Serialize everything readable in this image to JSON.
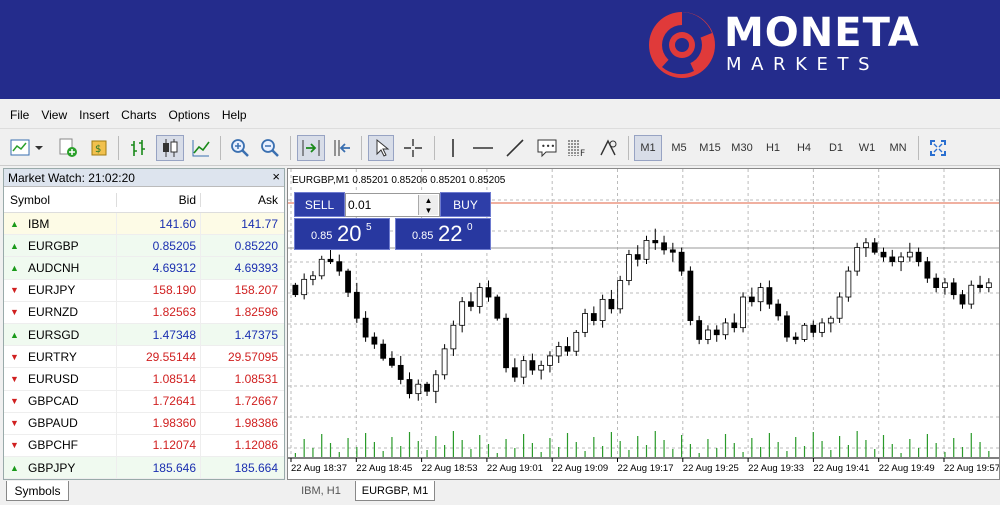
{
  "brand": {
    "name": "MONETA",
    "sub": "MARKETS"
  },
  "menu": [
    "File",
    "View",
    "Insert",
    "Charts",
    "Options",
    "Help"
  ],
  "timeframes": [
    "M1",
    "M5",
    "M15",
    "M30",
    "H1",
    "H4",
    "D1",
    "W1",
    "MN"
  ],
  "active_timeframe": "M1",
  "market_watch": {
    "title": "Market Watch: 21:02:20",
    "close": "×",
    "headers": {
      "symbol": "Symbol",
      "bid": "Bid",
      "ask": "Ask"
    },
    "rows": [
      {
        "symbol": "IBM",
        "bid": "141.60",
        "ask": "141.77",
        "dir": "up"
      },
      {
        "symbol": "EURGBP",
        "bid": "0.85205",
        "ask": "0.85220",
        "dir": "up"
      },
      {
        "symbol": "AUDCNH",
        "bid": "4.69312",
        "ask": "4.69393",
        "dir": "up"
      },
      {
        "symbol": "EURJPY",
        "bid": "158.190",
        "ask": "158.207",
        "dir": "down"
      },
      {
        "symbol": "EURNZD",
        "bid": "1.82563",
        "ask": "1.82596",
        "dir": "down"
      },
      {
        "symbol": "EURSGD",
        "bid": "1.47348",
        "ask": "1.47375",
        "dir": "up"
      },
      {
        "symbol": "EURTRY",
        "bid": "29.55144",
        "ask": "29.57095",
        "dir": "down"
      },
      {
        "symbol": "EURUSD",
        "bid": "1.08514",
        "ask": "1.08531",
        "dir": "down"
      },
      {
        "symbol": "GBPCAD",
        "bid": "1.72641",
        "ask": "1.72667",
        "dir": "down"
      },
      {
        "symbol": "GBPAUD",
        "bid": "1.98360",
        "ask": "1.98386",
        "dir": "down"
      },
      {
        "symbol": "GBPCHF",
        "bid": "1.12074",
        "ask": "1.12086",
        "dir": "down"
      },
      {
        "symbol": "GBPJPY",
        "bid": "185.646",
        "ask": "185.664",
        "dir": "up"
      }
    ],
    "tab": "Symbols"
  },
  "chart": {
    "info": "EURGBP,M1  0.85201 0.85206 0.85201 0.85205",
    "sell_label": "SELL",
    "buy_label": "BUY",
    "lot": "0.01",
    "sell_quote": {
      "pre": "0.85",
      "big": "20",
      "sup": "5"
    },
    "buy_quote": {
      "pre": "0.85",
      "big": "22",
      "sup": "0"
    },
    "time_labels": [
      "22 Aug 18:37",
      "22 Aug 18:45",
      "22 Aug 18:53",
      "22 Aug 19:01",
      "22 Aug 19:09",
      "22 Aug 19:17",
      "22 Aug 19:25",
      "22 Aug 19:33",
      "22 Aug 19:41",
      "22 Aug 19:49",
      "22 Aug 19:57"
    ],
    "candles": [
      [
        0.8522,
        0.85222,
        0.8521,
        0.85212
      ],
      [
        0.85212,
        0.8523,
        0.85208,
        0.85225
      ],
      [
        0.85225,
        0.85232,
        0.8522,
        0.85228
      ],
      [
        0.85228,
        0.85245,
        0.85225,
        0.85242
      ],
      [
        0.85242,
        0.8525,
        0.85238,
        0.8524
      ],
      [
        0.8524,
        0.85246,
        0.85228,
        0.85232
      ],
      [
        0.85232,
        0.85234,
        0.8521,
        0.85214
      ],
      [
        0.85214,
        0.85222,
        0.85188,
        0.85192
      ],
      [
        0.85192,
        0.85198,
        0.85172,
        0.85176
      ],
      [
        0.85176,
        0.8518,
        0.85166,
        0.8517
      ],
      [
        0.8517,
        0.85174,
        0.85156,
        0.85158
      ],
      [
        0.85158,
        0.85164,
        0.8515,
        0.85152
      ],
      [
        0.85152,
        0.8516,
        0.85136,
        0.8514
      ],
      [
        0.8514,
        0.85146,
        0.85124,
        0.85128
      ],
      [
        0.85128,
        0.8514,
        0.85122,
        0.85136
      ],
      [
        0.85136,
        0.85138,
        0.85126,
        0.8513
      ],
      [
        0.8513,
        0.85148,
        0.8512,
        0.85144
      ],
      [
        0.85144,
        0.8517,
        0.8514,
        0.85166
      ],
      [
        0.85166,
        0.8519,
        0.8516,
        0.85186
      ],
      [
        0.85186,
        0.8521,
        0.8518,
        0.85206
      ],
      [
        0.85206,
        0.85214,
        0.85198,
        0.85202
      ],
      [
        0.85202,
        0.85222,
        0.85196,
        0.85218
      ],
      [
        0.85218,
        0.85224,
        0.85206,
        0.8521
      ],
      [
        0.8521,
        0.85212,
        0.8519,
        0.85192
      ],
      [
        0.85192,
        0.85196,
        0.85146,
        0.8515
      ],
      [
        0.8515,
        0.85158,
        0.85138,
        0.85142
      ],
      [
        0.85142,
        0.8516,
        0.85136,
        0.85156
      ],
      [
        0.85156,
        0.85162,
        0.85144,
        0.85148
      ],
      [
        0.85148,
        0.85156,
        0.8514,
        0.85152
      ],
      [
        0.85152,
        0.85164,
        0.85146,
        0.8516
      ],
      [
        0.8516,
        0.85172,
        0.85154,
        0.85168
      ],
      [
        0.85168,
        0.85176,
        0.8516,
        0.85164
      ],
      [
        0.85164,
        0.85182,
        0.8516,
        0.8518
      ],
      [
        0.8518,
        0.852,
        0.85176,
        0.85196
      ],
      [
        0.85196,
        0.85202,
        0.85186,
        0.8519
      ],
      [
        0.8519,
        0.85212,
        0.85184,
        0.85208
      ],
      [
        0.85208,
        0.85216,
        0.85196,
        0.852
      ],
      [
        0.852,
        0.85228,
        0.85196,
        0.85224
      ],
      [
        0.85224,
        0.8525,
        0.8522,
        0.85246
      ],
      [
        0.85246,
        0.85254,
        0.85236,
        0.85242
      ],
      [
        0.85242,
        0.85262,
        0.85238,
        0.85258
      ],
      [
        0.85258,
        0.85268,
        0.8525,
        0.85256
      ],
      [
        0.85256,
        0.85262,
        0.85246,
        0.8525
      ],
      [
        0.8525,
        0.85256,
        0.8524,
        0.85248
      ],
      [
        0.85248,
        0.85252,
        0.85228,
        0.85232
      ],
      [
        0.85232,
        0.85236,
        0.85186,
        0.8519
      ],
      [
        0.8519,
        0.85194,
        0.8517,
        0.85174
      ],
      [
        0.85174,
        0.85186,
        0.8517,
        0.85182
      ],
      [
        0.85182,
        0.85186,
        0.85172,
        0.85178
      ],
      [
        0.85178,
        0.85192,
        0.85174,
        0.85188
      ],
      [
        0.85188,
        0.85196,
        0.8518,
        0.85184
      ],
      [
        0.85184,
        0.85214,
        0.8518,
        0.8521
      ],
      [
        0.8521,
        0.85218,
        0.85202,
        0.85206
      ],
      [
        0.85206,
        0.85222,
        0.85198,
        0.85218
      ],
      [
        0.85218,
        0.85224,
        0.852,
        0.85204
      ],
      [
        0.85204,
        0.85208,
        0.8519,
        0.85194
      ],
      [
        0.85194,
        0.85198,
        0.85172,
        0.85176
      ],
      [
        0.85176,
        0.8518,
        0.8517,
        0.85174
      ],
      [
        0.85174,
        0.85188,
        0.85172,
        0.85186
      ],
      [
        0.85186,
        0.8519,
        0.85176,
        0.8518
      ],
      [
        0.8518,
        0.85192,
        0.85176,
        0.85188
      ],
      [
        0.85188,
        0.85194,
        0.8518,
        0.85192
      ],
      [
        0.85192,
        0.85214,
        0.85188,
        0.8521
      ],
      [
        0.8521,
        0.85236,
        0.85206,
        0.85232
      ],
      [
        0.85232,
        0.85256,
        0.85228,
        0.85252
      ],
      [
        0.85252,
        0.8526,
        0.85244,
        0.85256
      ],
      [
        0.85256,
        0.8526,
        0.85246,
        0.85248
      ],
      [
        0.85248,
        0.85252,
        0.8524,
        0.85244
      ],
      [
        0.85244,
        0.8525,
        0.85236,
        0.8524
      ],
      [
        0.8524,
        0.85248,
        0.85232,
        0.85244
      ],
      [
        0.85244,
        0.85256,
        0.8524,
        0.85248
      ],
      [
        0.85248,
        0.85252,
        0.85236,
        0.8524
      ],
      [
        0.8524,
        0.85244,
        0.85222,
        0.85226
      ],
      [
        0.85226,
        0.8523,
        0.85214,
        0.85218
      ],
      [
        0.85218,
        0.85226,
        0.85212,
        0.85222
      ],
      [
        0.85222,
        0.85226,
        0.85208,
        0.85212
      ],
      [
        0.85212,
        0.85216,
        0.852,
        0.85204
      ],
      [
        0.85204,
        0.85224,
        0.852,
        0.8522
      ],
      [
        0.8522,
        0.85228,
        0.85214,
        0.85218
      ],
      [
        0.85218,
        0.85226,
        0.85214,
        0.85222
      ]
    ]
  }
}
